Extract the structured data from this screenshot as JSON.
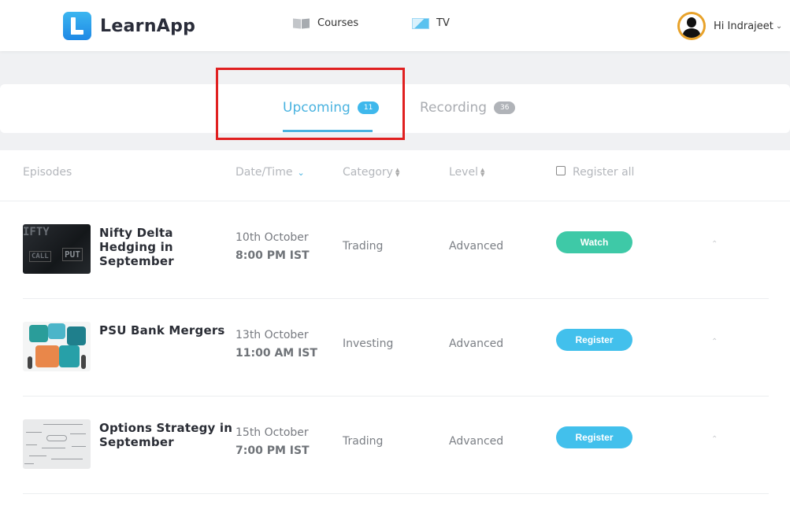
{
  "app": {
    "name": "LearnApp"
  },
  "nav": [
    {
      "label": "Courses",
      "icon": "book-icon"
    },
    {
      "label": "TV",
      "icon": "tv-icon"
    }
  ],
  "user": {
    "greeting": "Hi Indrajeet"
  },
  "tabs": [
    {
      "label": "Upcoming",
      "count": "11",
      "active": true
    },
    {
      "label": "Recording",
      "count": "36",
      "active": false
    }
  ],
  "table": {
    "headers": {
      "episodes": "Episodes",
      "date": "Date/Time",
      "category": "Category",
      "level": "Level",
      "register_all": "Register all"
    },
    "rows": [
      {
        "title": "Nifty Delta Hedging in September",
        "date": "10th October",
        "time": "8:00 PM IST",
        "category": "Trading",
        "level": "Advanced",
        "action": "Watch"
      },
      {
        "title": "PSU Bank Mergers",
        "date": "13th October",
        "time": "11:00 AM IST",
        "category": "Investing",
        "level": "Advanced",
        "action": "Register"
      },
      {
        "title": "Options Strategy in September",
        "date": "15th October",
        "time": "7:00 PM IST",
        "category": "Trading",
        "level": "Advanced",
        "action": "Register"
      }
    ]
  },
  "colors": {
    "accent": "#4ab3e0",
    "watch": "#3ec9a7",
    "register": "#42c0ec",
    "highlight": "#e02020"
  }
}
